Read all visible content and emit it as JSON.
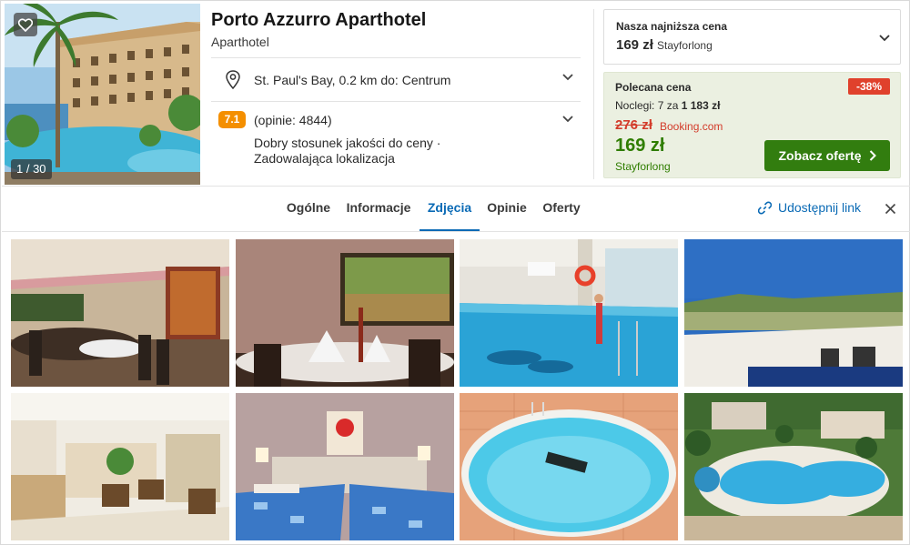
{
  "hotel": {
    "name": "Porto Azzurro Aparthotel",
    "type": "Aparthotel",
    "photo_counter": "1 / 30",
    "location": "St. Paul's Bay, 0.2 km do: Centrum",
    "rating_score": "7.1",
    "reviews": "(opinie: 4844)",
    "desc_line1": "Dobry stosunek jakości do ceny ·",
    "desc_line2": "Zadowalająca lokalizacja"
  },
  "lowest_price": {
    "label": "Nasza najniższa cena",
    "price": "169 zł",
    "source": "Stayforlong"
  },
  "recommended": {
    "label": "Polecana cena",
    "discount": "-38%",
    "nights_prefix": "Noclegi: 7 za",
    "nights_total": "1 183 zł",
    "old_price": "276 zł",
    "old_source": "Booking.com",
    "new_price": "169 zł",
    "new_source": "Stayforlong",
    "cta": "Zobacz ofertę"
  },
  "tabs": [
    "Ogólne",
    "Informacje",
    "Zdjęcia",
    "Opinie",
    "Oferty"
  ],
  "active_tab": "Zdjęcia",
  "share_label": "Udostępnij link",
  "icons": {
    "favorite": "heart-icon",
    "location": "map-pin-icon",
    "expand": "chevron-down-icon",
    "next": "chevron-right-icon",
    "share": "link-icon",
    "close": "close-icon"
  },
  "colors": {
    "accent": "#0a6ab5",
    "cta": "#327d0f",
    "discount": "#e0412c",
    "rating": "#f48f00",
    "recommended_bg": "#ebf0e1"
  },
  "gallery": [
    "restaurant-photo",
    "dining-table-aquarium-photo",
    "indoor-pool-photo",
    "rooftop-view-photo",
    "lobby-photo",
    "bedroom-photo",
    "outdoor-pool-photo",
    "aerial-pool-photo"
  ]
}
